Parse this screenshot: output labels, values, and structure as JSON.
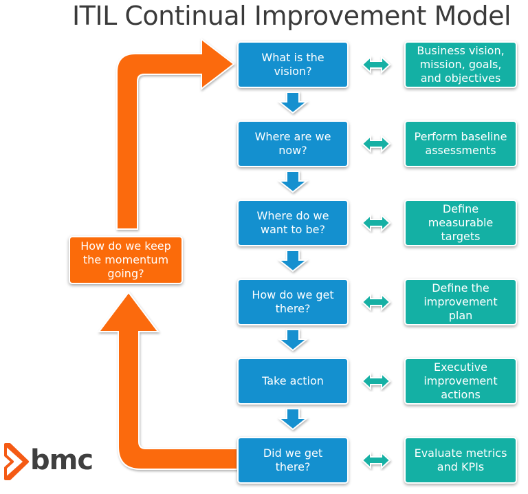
{
  "title": "ITIL Continual Improvement Model",
  "colors": {
    "step_box": "#1490cf",
    "outcome_box": "#14b0a4",
    "loop": "#fb6b0a",
    "logo_text": "#3f3f3f"
  },
  "steps": [
    {
      "question": "What is the vision?",
      "outcome": "Business vision, mission, goals, and objectives"
    },
    {
      "question": "Where are we now?",
      "outcome": "Perform baseline assessments"
    },
    {
      "question": "Where do we want to be?",
      "outcome": "Define measurable targets"
    },
    {
      "question": "How do we get there?",
      "outcome": "Define the improvement plan"
    },
    {
      "question": "Take action",
      "outcome": "Executive improvement actions"
    },
    {
      "question": "Did we get there?",
      "outcome": "Evaluate metrics and KPIs"
    }
  ],
  "loop_box": "How do we keep the momentum going?",
  "logo": {
    "text": "bmc",
    "icon": "bmc-chevron-logo-icon"
  }
}
